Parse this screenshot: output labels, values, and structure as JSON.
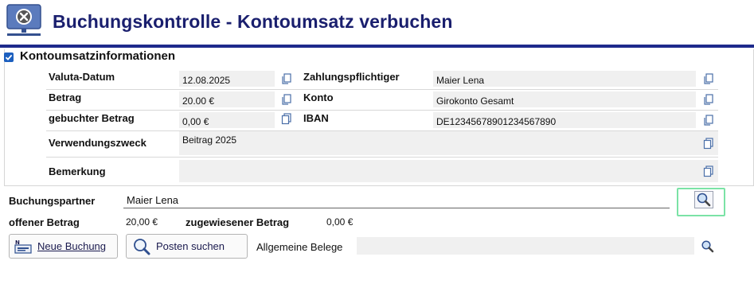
{
  "header": {
    "title": "Buchungskontrolle - Kontoumsatz verbuchen"
  },
  "section": {
    "title": "Kontoumsatzinformationen",
    "checked": true
  },
  "fields": {
    "valuta_datum": {
      "label": "Valuta-Datum",
      "value": "12.08.2025"
    },
    "betrag": {
      "label": "Betrag",
      "value": "20.00 €"
    },
    "gebuchter_betrag": {
      "label": "gebuchter Betrag",
      "value": "0,00 €"
    },
    "zahlungspflichtiger": {
      "label": "Zahlungspflichtiger",
      "value": "Maier Lena"
    },
    "konto": {
      "label": "Konto",
      "value": "Girokonto Gesamt"
    },
    "iban": {
      "label": "IBAN",
      "value": "DE12345678901234567890"
    },
    "verwendungszweck": {
      "label": "Verwendungszweck",
      "value": "Beitrag 2025"
    },
    "bemerkung": {
      "label": "Bemerkung",
      "value": ""
    }
  },
  "partner": {
    "label": "Buchungspartner",
    "value": "Maier Lena"
  },
  "amounts": {
    "offener_label": "offener Betrag",
    "offener_value": "20,00 €",
    "zugewiesen_label": "zugewiesener Betrag",
    "zugewiesen_value": "0,00 €"
  },
  "actions": {
    "neue_buchung": "Neue Buchung",
    "posten_suchen": "Posten suchen",
    "belege_label": "Allgemeine Belege"
  },
  "colors": {
    "title": "#1a1f6e",
    "rule": "#1e2a8c",
    "highlight": "#7be3a6",
    "checkbox": "#1c5fbf"
  },
  "icons": {
    "app": "monitor-error-icon",
    "copy": "copy-icon",
    "search": "magnifier-icon",
    "new": "new-booking-icon"
  }
}
